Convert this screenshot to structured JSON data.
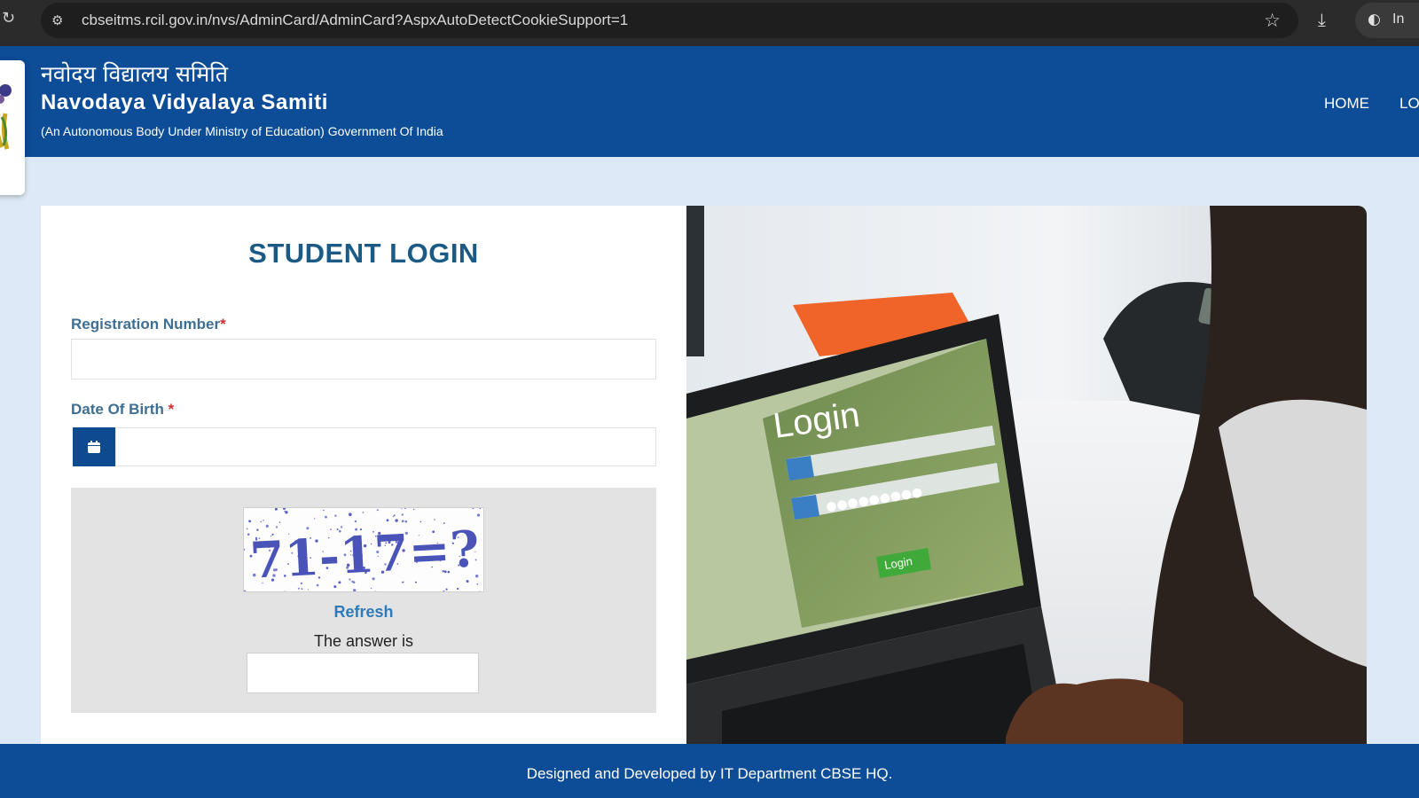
{
  "browser": {
    "url": "cbseitms.rcil.gov.in/nvs/AdminCard/AdminCard?AspxAutoDetectCookieSupport=1",
    "reload_icon": "reload-icon",
    "star_icon": "bookmark-star-icon",
    "download_icon": "download-icon",
    "profile_label": "In"
  },
  "header": {
    "hindi_title": "नवोदय विद्यालय समिति",
    "title": "Navodaya Vidyalaya Samiti",
    "subtitle": "(An Autonomous Body Under Ministry of Education) Government Of India",
    "nav": {
      "home": "HOME",
      "login": "LO"
    },
    "color": "#0d4c96"
  },
  "login_form": {
    "title": "STUDENT LOGIN",
    "registration_label": "Registration Number",
    "registration_value": "",
    "dob_label": "Date Of Birth ",
    "dob_value": "",
    "required_marker": "*",
    "captcha": {
      "text": "71-17=?",
      "refresh_label": "Refresh",
      "answer_label": "The answer is",
      "answer_value": ""
    }
  },
  "photo": {
    "screen_title": "Login",
    "screen_button": "Login",
    "screen_password": "●●●●●●●●●"
  },
  "footer": {
    "text": "Designed and Developed by IT Department CBSE HQ."
  },
  "colors": {
    "page_bg": "#dde9f6",
    "title_color": "#1c5a86",
    "label_color": "#3e6e93",
    "link_color": "#2f7ab8"
  }
}
